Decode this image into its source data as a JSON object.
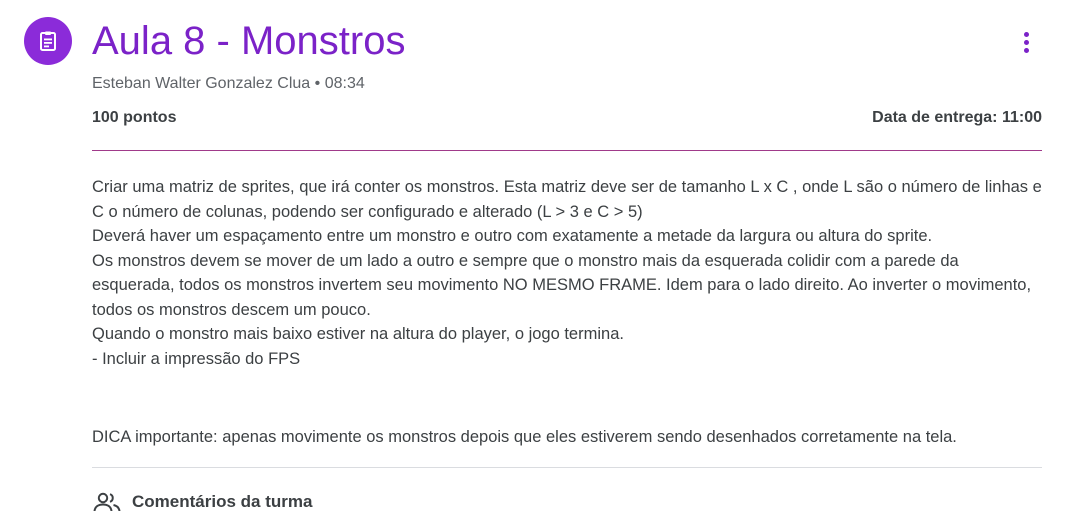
{
  "header": {
    "title": "Aula 8 - Monstros",
    "author": "Esteban Walter Gonzalez Clua",
    "separator": "•",
    "posted_time": "08:34",
    "points": "100 pontos",
    "due": "Data de entrega: 11:00",
    "icon": "assignment-icon",
    "menu_icon": "more-vert-icon"
  },
  "description": {
    "lines": [
      "Criar uma matriz de sprites, que irá conter os monstros. Esta matriz deve ser de tamanho L x C , onde L são o número de linhas e C o número de colunas, podendo ser configurado e alterado (L > 3 e C > 5)",
      "Deverá haver um espaçamento entre um monstro e outro com exatamente a metade da largura ou altura do sprite.",
      "Os monstros devem se mover de um lado a outro e sempre que o monstro mais da esquerada colidir com a parede da esquerada, todos os monstros invertem seu movimento NO MESMO FRAME.  Idem para o lado direito. Ao inverter o movimento, todos os monstros descem um pouco.",
      "Quando o monstro mais baixo estiver na altura do player, o jogo termina.",
      "- Incluir a impressão do FPS"
    ],
    "tip": "DICA importante: apenas movimente os monstros depois que eles estiverem sendo desenhados corretamente na tela."
  },
  "comments": {
    "label": "Comentários da turma",
    "icon": "people-icon"
  },
  "colors": {
    "accent": "#7b22c8",
    "icon_bg": "#8b2bd9",
    "divider": "#a03a8a",
    "text": "#3c4043",
    "muted": "#5f6368"
  }
}
